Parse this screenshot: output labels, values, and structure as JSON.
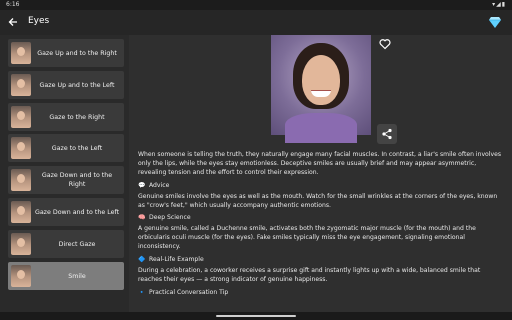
{
  "status": {
    "time": "6:16"
  },
  "appbar": {
    "title": "Eyes"
  },
  "sidebar": {
    "items": [
      {
        "label": "Gaze Up and to the Right",
        "active": false
      },
      {
        "label": "Gaze Up and to the Left",
        "active": false
      },
      {
        "label": "Gaze to the Right",
        "active": false
      },
      {
        "label": "Gaze to the Left",
        "active": false
      },
      {
        "label": "Gaze Down and to the Right",
        "active": false
      },
      {
        "label": "Gaze Down and to the Left",
        "active": false
      },
      {
        "label": "Direct Gaze",
        "active": false
      },
      {
        "label": "Smile",
        "active": true
      }
    ]
  },
  "content": {
    "intro": "When someone is telling the truth, they naturally engage many facial muscles. In contrast, a liar's smile often involves only the lips, while the eyes stay emotionless. Deceptive smiles are usually brief and may appear asymmetric, revealing tension and the effort to control their expression.",
    "sections": [
      {
        "icon": "speech-bubble-icon",
        "glyph": "💬",
        "title": "Advice",
        "body": "Genuine smiles involve the eyes as well as the mouth. Watch for the small wrinkles at the corners of the eyes, known as \"crow's feet,\" which usually accompany authentic emotions."
      },
      {
        "icon": "brain-icon",
        "glyph": "🧠",
        "title": "Deep Science",
        "body": "A genuine smile, called a Duchenne smile, activates both the zygomatic major muscle (for the mouth) and the orbicularis oculi muscle (for the eyes). Fake smiles typically miss the eye engagement, signaling emotional inconsistency."
      },
      {
        "icon": "diamond-icon",
        "glyph": "🔷",
        "title": "Real-Life Example",
        "body": "During a celebration, a coworker receives a surprise gift and instantly lights up with a wide, balanced smile that reaches their eyes — a strong indicator of genuine happiness."
      },
      {
        "icon": "tip-icon",
        "glyph": "🔹",
        "title": "Practical Conversation Tip",
        "body": ""
      }
    ]
  },
  "colors": {
    "active_item": "#7d7d7d",
    "item_bg": "#3a3a3a",
    "background": "#2f2f2f"
  }
}
